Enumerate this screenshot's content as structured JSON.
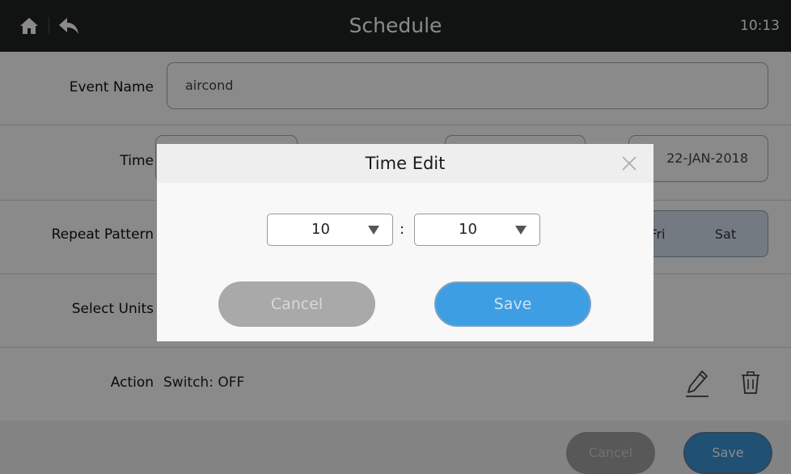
{
  "header": {
    "title": "Schedule",
    "time": "10:13"
  },
  "form": {
    "event_name": {
      "label": "Event Name",
      "value": "aircond"
    },
    "time": {
      "label": "Time",
      "date_value": "22-JAN-2018"
    },
    "repeat_pattern": {
      "label": "Repeat Pattern",
      "visible_days": [
        "Fri",
        "Sat"
      ]
    },
    "select_units": {
      "label": "Select Units"
    },
    "action": {
      "label": "Action",
      "value": "Switch: OFF"
    }
  },
  "footer": {
    "cancel_label": "Cancel",
    "save_label": "Save"
  },
  "dialog": {
    "title": "Time Edit",
    "hour": "10",
    "separator": ":",
    "minute": "10",
    "cancel_label": "Cancel",
    "save_label": "Save"
  },
  "icons": {
    "home": "home-icon",
    "back": "back-arrow-icon",
    "close": "close-icon",
    "edit": "pencil-icon",
    "delete": "trash-icon",
    "dropdown": "caret-down-icon"
  },
  "colors": {
    "titlebar": "#1f2322",
    "accent_blue": "#3b95d6",
    "day_selected": "#d4e2ee"
  }
}
